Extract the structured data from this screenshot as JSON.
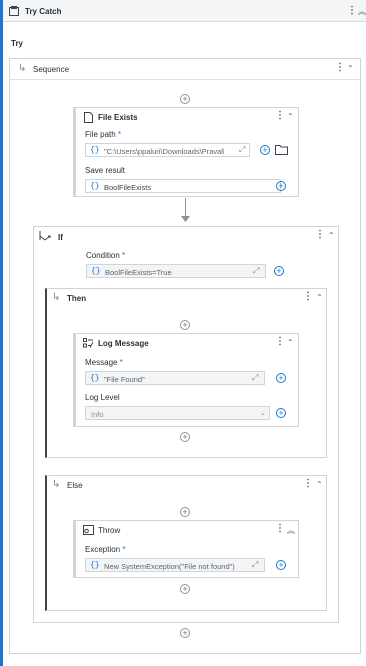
{
  "try_catch": {
    "title": "Try Catch"
  },
  "try": {
    "label": "Try"
  },
  "sequence": {
    "label": "Sequence"
  },
  "file_exists": {
    "title": "File Exists",
    "file_path_label": "File path",
    "required_mark": "*",
    "file_path_value": "\"C:\\Users\\ppaluri\\Downloads\\Pravallik",
    "save_result_label": "Save result",
    "save_result_value": "BoolFileExists"
  },
  "if_block": {
    "label": "If",
    "condition_label": "Condition",
    "condition_value": "BoolFileExists=True"
  },
  "then_block": {
    "label": "Then"
  },
  "log_message": {
    "title": "Log Message",
    "message_label": "Message",
    "message_value": "\"File Found\"",
    "log_level_label": "Log Level",
    "log_level_value": "Info"
  },
  "else_block": {
    "label": "Else"
  },
  "throw": {
    "title": "Throw",
    "exception_label": "Exception",
    "exception_value": "New SystemException(\"File not found\")"
  },
  "icons": {
    "expression": "{}",
    "plus": "+",
    "more": "⋮",
    "collapse": "⌃",
    "double_collapse": "︽",
    "expand_field": "⤢",
    "branch": "↳"
  }
}
